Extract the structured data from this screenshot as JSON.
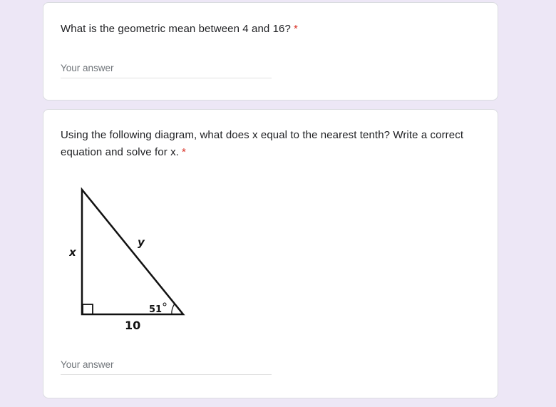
{
  "questions": [
    {
      "text": "What is the geometric mean between 4 and 16?",
      "required_mark": "*",
      "answer_placeholder": "Your answer"
    },
    {
      "text": "Using the following diagram, what does x equal to the nearest tenth? Write a correct equation and solve for x.",
      "required_mark": "*",
      "answer_placeholder": "Your answer",
      "diagram": {
        "label_x": "x",
        "label_y": "y",
        "label_angle": "51",
        "label_base": "10"
      }
    }
  ],
  "colors": {
    "page_background": "#ede7f6",
    "card_background": "#ffffff",
    "required_mark": "#d93025",
    "placeholder_text": "#70757a"
  }
}
